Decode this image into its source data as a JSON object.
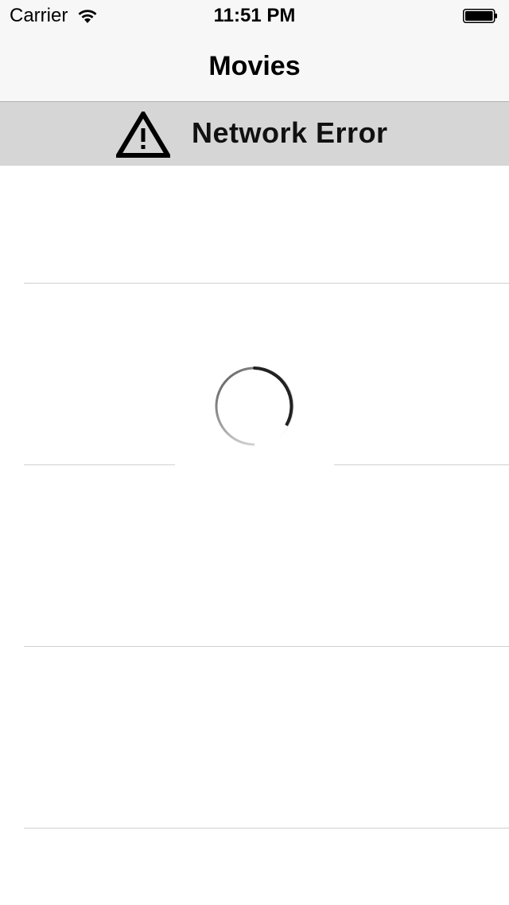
{
  "status_bar": {
    "carrier": "Carrier",
    "time": "11:51 PM",
    "wifi_icon": "wifi-icon",
    "battery_icon": "battery-icon"
  },
  "nav": {
    "title": "Movies"
  },
  "error_banner": {
    "icon": "warning-icon",
    "text": "Network Error",
    "background": "#d6d6d6"
  },
  "list": {
    "rows": [
      {
        "name": "row-1"
      },
      {
        "name": "row-2"
      },
      {
        "name": "row-3"
      },
      {
        "name": "row-4"
      }
    ]
  },
  "loading": {
    "icon": "loading-spinner-icon"
  }
}
